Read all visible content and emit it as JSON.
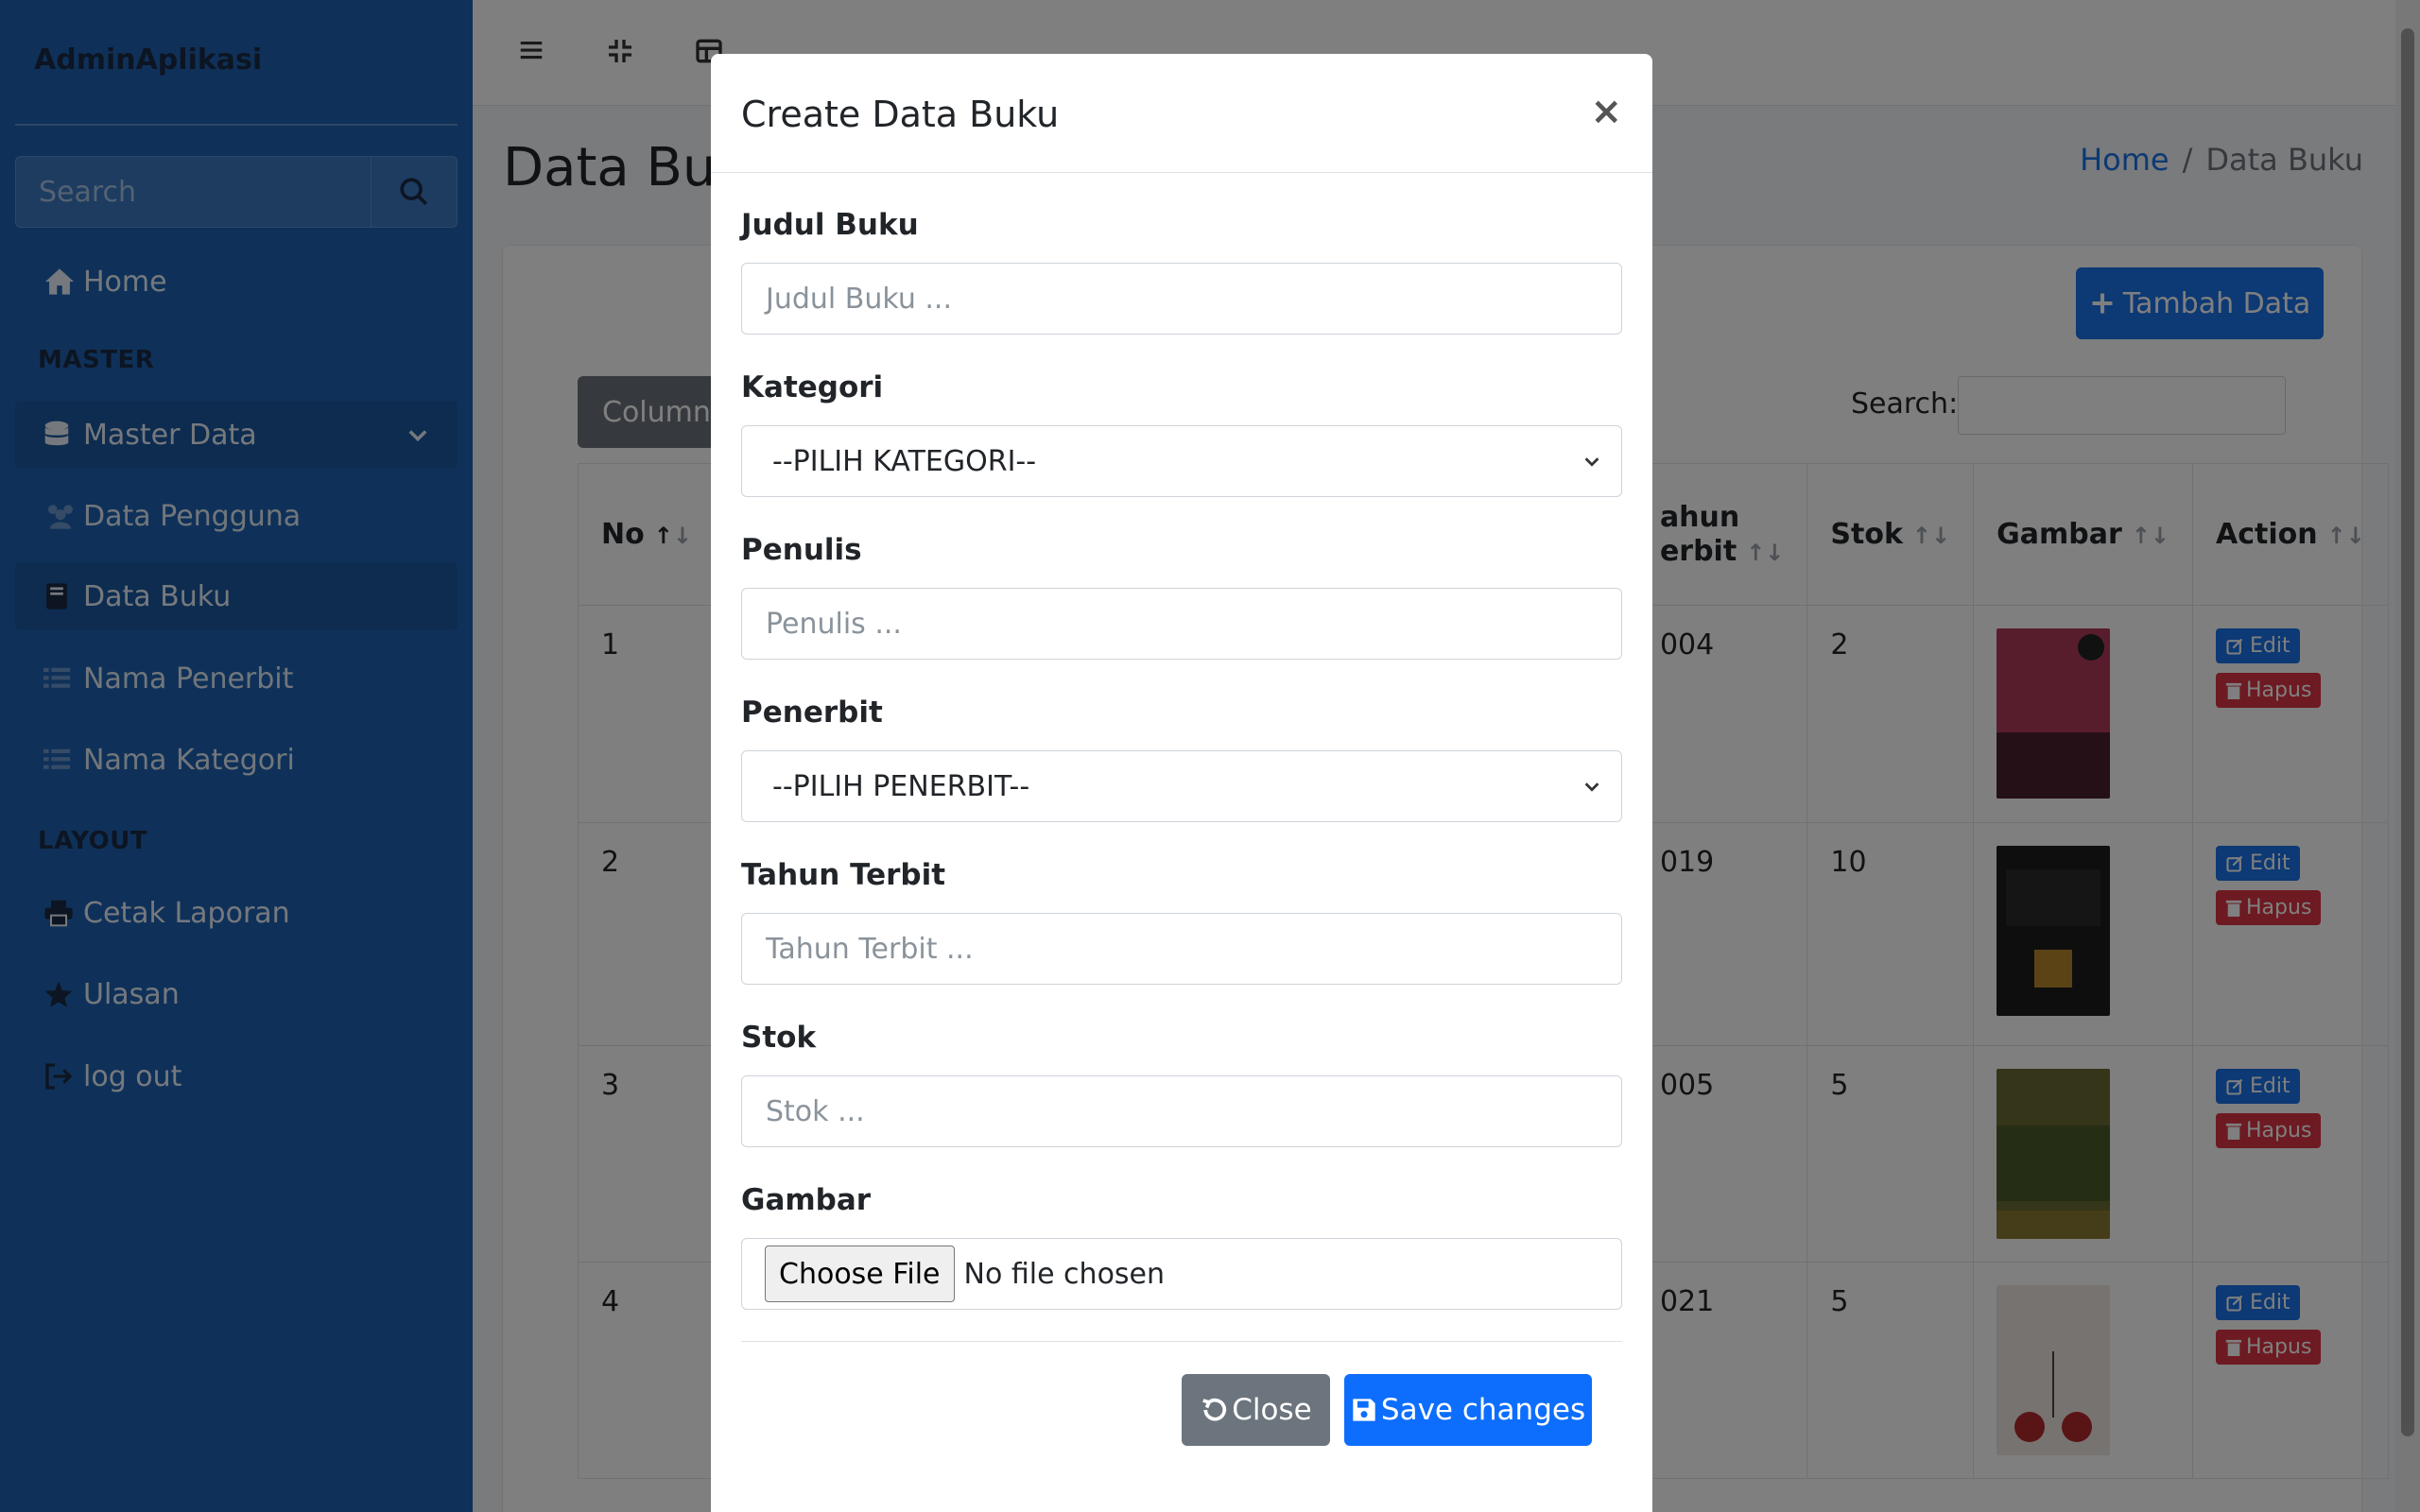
{
  "brand": "AdminAplikasi",
  "sidebar": {
    "search_placeholder": "Search",
    "home": "Home",
    "header_master": "MASTER",
    "master_data": "Master Data",
    "data_pengguna": "Data Pengguna",
    "data_buku": "Data Buku",
    "nama_penerbit": "Nama Penerbit",
    "nama_kategori": "Nama Kategori",
    "header_layout": "LAYOUT",
    "cetak_laporan": "Cetak Laporan",
    "ulasan": "Ulasan",
    "logout": "log out"
  },
  "page": {
    "title": "Data Buku",
    "breadcrumb_home": "Home",
    "breadcrumb_sep": "/",
    "breadcrumb_current": "Data Buku",
    "tambah_label": "Tambah Data",
    "column_label": "Column",
    "search_label": "Search:"
  },
  "table": {
    "headers": {
      "no": "No",
      "tahun_1": "ahun",
      "tahun_2": "erbit",
      "stok": "Stok",
      "gambar": "Gambar",
      "action": "Action"
    },
    "rows": [
      {
        "no": "1",
        "tahun": "004",
        "stok": "2",
        "cover_color": "#b03a5b"
      },
      {
        "no": "2",
        "tahun": "019",
        "stok": "10",
        "cover_color": "#1c1c1c"
      },
      {
        "no": "3",
        "tahun": "005",
        "stok": "5",
        "cover_color": "#6b6a32"
      },
      {
        "no": "4",
        "tahun": "021",
        "stok": "5",
        "cover_color": "#efe7e3"
      }
    ],
    "edit_label": "Edit",
    "hapus_label": "Hapus"
  },
  "modal": {
    "title": "Create Data Buku",
    "close_symbol": "×",
    "fields": {
      "judul": {
        "label": "Judul Buku",
        "placeholder": "Judul Buku ..."
      },
      "kategori": {
        "label": "Kategori",
        "value": "--PILIH KATEGORI--"
      },
      "penulis": {
        "label": "Penulis",
        "placeholder": "Penulis ..."
      },
      "penerbit": {
        "label": "Penerbit",
        "value": "--PILIH PENERBIT--"
      },
      "tahun": {
        "label": "Tahun Terbit",
        "placeholder": "Tahun Terbit ..."
      },
      "stok": {
        "label": "Stok",
        "placeholder": "Stok ..."
      },
      "gambar": {
        "label": "Gambar",
        "button": "Choose File",
        "status": "No file chosen"
      }
    },
    "close_label": "Close",
    "save_label": "Save changes"
  },
  "colors": {
    "sidebar": "#1e63b3",
    "primary": "#0d6efd",
    "danger": "#dc3545",
    "secondary": "#6c757d"
  }
}
